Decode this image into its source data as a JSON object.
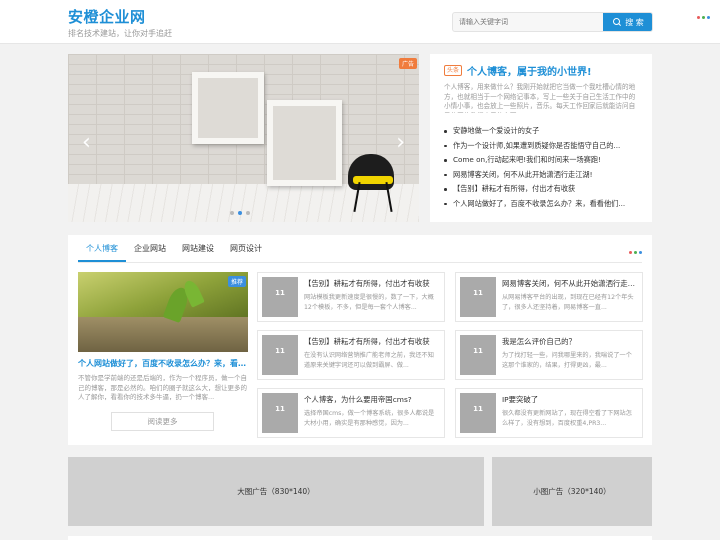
{
  "header": {
    "logo_title": "安橙企业网",
    "logo_subtitle": "排名技术建站，让你对手追赶",
    "search_placeholder": "请输入关键字词",
    "search_button": "搜 索",
    "menu_icon": "three-dots-menu-icon"
  },
  "banner": {
    "ad_tag": "广告",
    "prev_icon": "chevron-left-icon",
    "next_icon": "chevron-right-icon",
    "slides_count": 3,
    "active_slide": 2
  },
  "featured": {
    "badge": "头条",
    "title": "个人博客，属于我的小世界!",
    "description": "个人博客，用来做什么？我刚开始就把它当做一个我吐槽心情的地方，也就相当于一个网络记事本，写上一些关于自己生活工作中的小情小事，也会放上一些照片，音乐。每天工作回家后就能访问自己的网络数据库里的东西。",
    "list": [
      "安静地做一个爱设计的女子",
      "作为一个设计师,如果遭到质疑你是否能悟守自己的...",
      "Come on,行动起来吧!我们和时间来一场赛跑!",
      "网易博客关闭，何不从此开始潇洒行走江湖!",
      "【告别】耕耘才有所得，付出才有收获",
      "个人网站做好了，百度不收录怎么办？来，看看他们..."
    ]
  },
  "tabs": {
    "items": [
      "个人博客",
      "企业网站",
      "网站建设",
      "网页设计"
    ],
    "active": 0,
    "menu_icon": "three-dots-menu-icon"
  },
  "big_card": {
    "tag": "推荐",
    "title": "个人网站做好了，百度不收录怎么办？来，看看他们...",
    "description": "不管你是学前端的还是后端的，作为一个程序员，做一个自己的博客，那是必然的。咱们的圈子就这么大，想让更多的人了解你，看看你的技术多牛逼，扔一个博客...",
    "read_more": "阅读更多"
  },
  "cards": [
    {
      "thumb": "11",
      "title": "【告别】耕耘才有所得，付出才有收获",
      "desc": "网站模板我更新速度是很慢的，数了一下，大概12个模板，不多，但是每一套个人博客..."
    },
    {
      "thumb": "11",
      "title": "网易博客关闭，何不从此开始潇洒行走江湖!",
      "desc": "从网易博客平台的出现，到现在已经有12个年头了，很多人还坚持着，网易博客一直..."
    },
    {
      "thumb": "11",
      "title": "【告别】耕耘才有所得，付出才有收获",
      "desc": "在没有认识网络营销推广能老师之前，我还不知道原来关键字词还可以做到霸屏、做..."
    },
    {
      "thumb": "11",
      "title": "我是怎么评价自己的？",
      "desc": "为了找打轻一些，问我哪里来的，我喘说了一个这那个谁家的，结果，打得更凶，最..."
    },
    {
      "thumb": "11",
      "title": "个人博客，为什么要用帝国cms?",
      "desc": "选择帝国cms，做一个博客系统，很多人都说是大材小用，确实是有那种感觉，因为..."
    },
    {
      "thumb": "11",
      "title": "IP要突破了",
      "desc": "很久都没有更新网站了，现在得空看了下网站怎么样了，没有想到，百度权重4,PR3..."
    }
  ],
  "ads": {
    "big": "大图广告（830*140）",
    "small": "小图广告（320*140）"
  },
  "colors": {
    "brand": "#1e8fd6",
    "ad_tag": "#f07c3d",
    "dot_red": "#e85b5b",
    "dot_green": "#4cb050",
    "dot_blue": "#3b8fe0"
  }
}
